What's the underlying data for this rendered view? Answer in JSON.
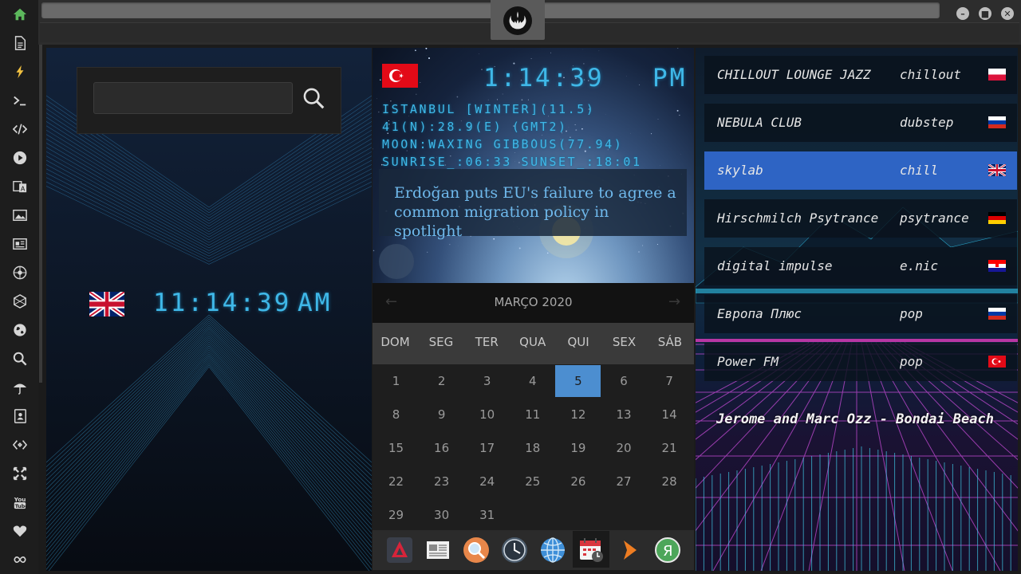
{
  "rail": {
    "icons": [
      "home-icon",
      "document-icon",
      "bolt-icon",
      "terminal-icon",
      "code-icon",
      "play-icon",
      "translate-icon",
      "image-icon",
      "news-icon",
      "rebel-icon",
      "hexagon-icon",
      "globe-icon",
      "search-icon",
      "umbrella-icon",
      "contacts-icon",
      "diamond-link-icon",
      "fullscreen-icon",
      "youtube-icon",
      "heart-icon",
      "infinity-icon"
    ],
    "accent": "#5cb85c"
  },
  "window": {
    "buttons": [
      "minimize",
      "maximize",
      "close"
    ]
  },
  "search": {
    "value": "",
    "placeholder": ""
  },
  "local_clock": {
    "time": "11:14:39",
    "ampm": "AM",
    "flag": "uk"
  },
  "world_clock": {
    "flag": "turkey",
    "time": "1:14:39",
    "ampm": "PM",
    "lines": [
      "ISTANBUL [WINTER](11.5)",
      "41(N):28.9(E) (GMT2)",
      "MOON:WAXING GIBBOUS(77.94)",
      "SUNRISE_:06:33 SUNSET_:18:01"
    ],
    "headline": "Erdoğan puts EU's failure to agree a common migration policy in spotlight"
  },
  "calendar": {
    "title": "MARÇO 2020",
    "prev": "←",
    "next": "→",
    "dows": [
      "DOM",
      "SEG",
      "TER",
      "QUA",
      "QUI",
      "SEX",
      "SÁB"
    ],
    "weeks": [
      [
        "1",
        "2",
        "3",
        "4",
        "5",
        "6",
        "7"
      ],
      [
        "8",
        "9",
        "10",
        "11",
        "12",
        "13",
        "14"
      ],
      [
        "15",
        "16",
        "17",
        "18",
        "19",
        "20",
        "21"
      ],
      [
        "22",
        "23",
        "24",
        "25",
        "26",
        "27",
        "28"
      ],
      [
        "29",
        "30",
        "31",
        "",
        "",
        "",
        ""
      ]
    ],
    "selected": "5",
    "selected_color": "#4c8ed0"
  },
  "dock": {
    "icons": [
      "arrow-app-icon",
      "news-app-icon",
      "search-app-icon",
      "clock-app-icon",
      "globe-app-icon",
      "calendar-app-icon",
      "play-app-icon",
      "yandex-app-icon"
    ]
  },
  "radio": {
    "stations": [
      {
        "name": "CHILLOUT LOUNGE JAZZ",
        "genre": "chillout",
        "flag": "poland"
      },
      {
        "name": "NEBULA CLUB",
        "genre": "dubstep",
        "flag": "russia"
      },
      {
        "name": "skylab",
        "genre": "chill",
        "flag": "uk"
      },
      {
        "name": "Hirschmilch Psytrance",
        "genre": "psytrance",
        "flag": "germany"
      },
      {
        "name": "digital impulse",
        "genre": "e.nic",
        "flag": "croatia"
      },
      {
        "name": "Европа Плюс",
        "genre": "pop",
        "flag": "russia"
      },
      {
        "name": "Power FM",
        "genre": "pop",
        "flag": "turkey"
      }
    ],
    "active_index": 2,
    "active_color": "#2e64c4",
    "now_playing": "Jerome and Marc Ozz - Bondai Beach"
  }
}
